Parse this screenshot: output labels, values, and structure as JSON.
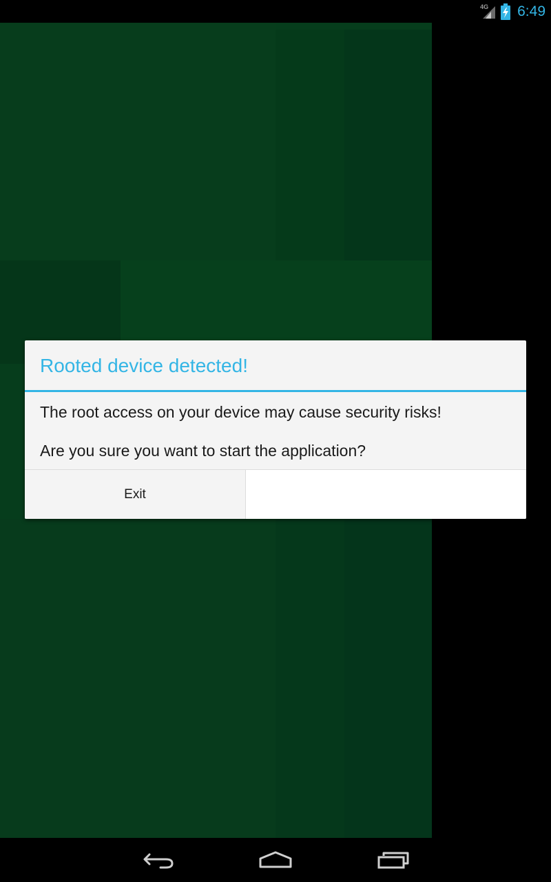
{
  "status_bar": {
    "network_label": "4G",
    "time": "6:49",
    "icons": [
      "signal-icon",
      "battery-charging-icon"
    ],
    "accent_color": "#33b5e5"
  },
  "dialog": {
    "title": "Rooted device detected!",
    "message_line_1": "The root access on your device may cause security risks!",
    "message_line_2": "Are you sure you want to start the application?",
    "exit_label": "Exit",
    "second_button_label": ""
  },
  "nav_bar": {
    "icons": [
      "back-icon",
      "home-icon",
      "recent-apps-icon"
    ]
  },
  "colors": {
    "title": "#33b5e5",
    "app_background": "#063d1c",
    "dialog_background": "#f4f4f4"
  }
}
